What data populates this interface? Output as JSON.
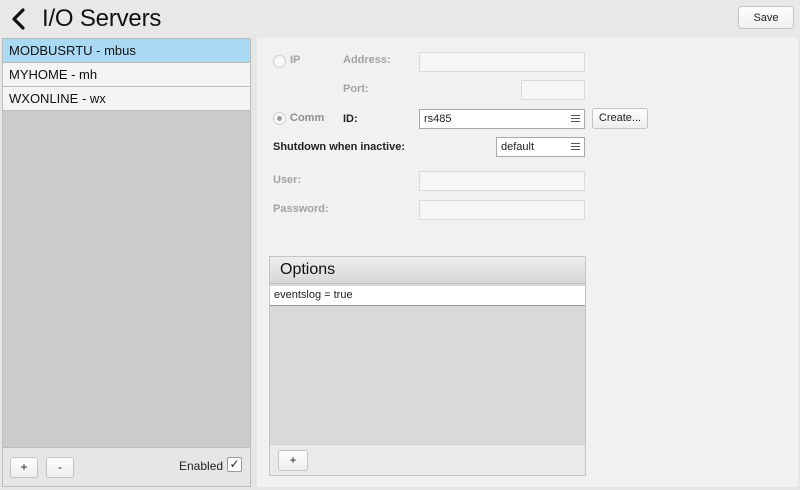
{
  "header": {
    "title": "I/O Servers",
    "save_label": "Save"
  },
  "servers": [
    {
      "label": "MODBUSRTU - mbus",
      "selected": true
    },
    {
      "label": "MYHOME - mh",
      "selected": false
    },
    {
      "label": "WXONLINE - wx",
      "selected": false
    }
  ],
  "left_footer": {
    "add_label": "+",
    "remove_label": "-",
    "enabled_label": "Enabled",
    "enabled_check": "✓",
    "enabled": true
  },
  "form": {
    "ip_label": "IP",
    "address_label": "Address:",
    "address_value": "",
    "port_label": "Port:",
    "port_value": "",
    "comm_label": "Comm",
    "connection_mode": "Comm",
    "id_label": "ID:",
    "id_value": "rs485",
    "create_label": "Create...",
    "shutdown_label": "Shutdown when inactive:",
    "shutdown_value": "default",
    "user_label": "User:",
    "user_value": "",
    "password_label": "Password:",
    "password_value": ""
  },
  "options": {
    "title": "Options",
    "rows": [
      "eventslog = true"
    ],
    "add_label": "+"
  },
  "icons": {
    "back": "chevron-left-icon",
    "menu": "list-menu-icon"
  }
}
